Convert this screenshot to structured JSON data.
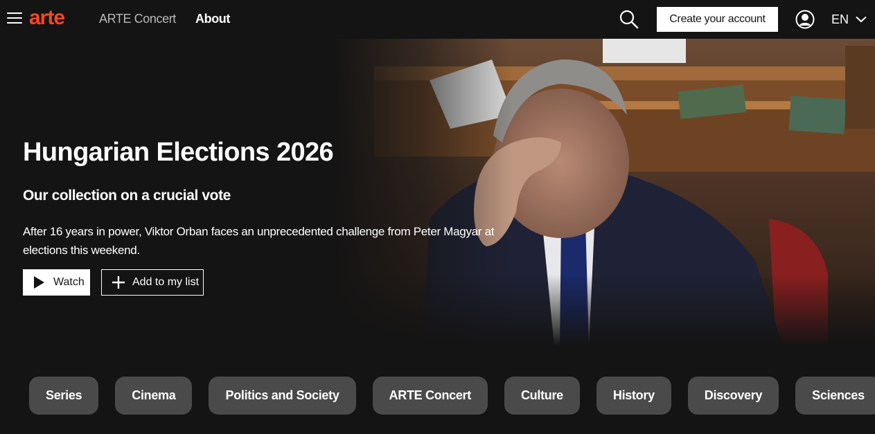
{
  "header": {
    "logo": "arte",
    "nav": [
      {
        "label": "ARTE Concert"
      },
      {
        "label": "About"
      }
    ],
    "create_account_label": "Create your account",
    "language": "EN",
    "icons": {
      "menu": "hamburger-menu-icon",
      "search": "search-icon",
      "account": "user-account-icon",
      "language_dropdown": "chevron-down-icon"
    }
  },
  "hero": {
    "title": "Hungarian Elections 2026",
    "subtitle": "Our collection on a crucial vote",
    "description": "After 16 years in power, Viktor Orban faces an unprecedented challenge from Peter Magyar at elections this weekend.",
    "watch_label": "Watch",
    "add_to_list_label": "Add to my list"
  },
  "categories": [
    "Series",
    "Cinema",
    "Politics and Society",
    "ARTE Concert",
    "Culture",
    "History",
    "Discovery",
    "Sciences"
  ],
  "colors": {
    "background": "#141414",
    "brand": "#fa481c",
    "chip": "#4a4a4a"
  }
}
